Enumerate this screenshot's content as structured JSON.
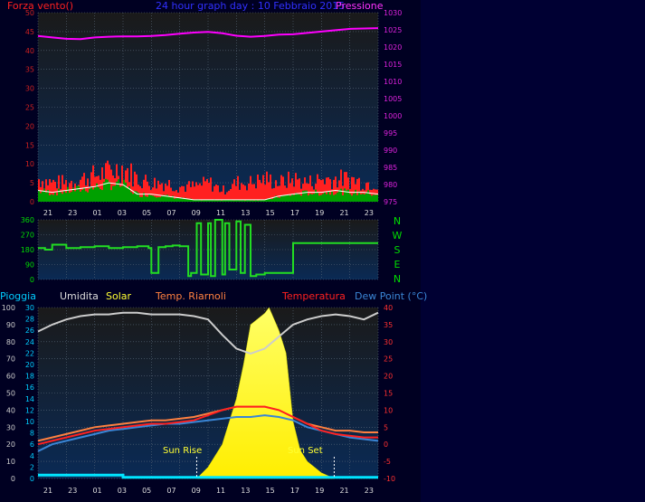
{
  "colors": {
    "page_bg": "#000033",
    "plot_bg_top": "#1a1a1a",
    "plot_bg_bottom": "#0a2a55",
    "grid": "#5a6a7a",
    "wind_gust": "#ff2020",
    "wind_avg": "#00a000",
    "wind_line": "#ffffff",
    "pressure": "#ff00ff",
    "direction": "#22dd22",
    "humidity": "#cccccc",
    "solar": "#ffff22",
    "temp_sheltered": "#ff8040",
    "temperature": "#ff2020",
    "dew_point": "#3a86d6",
    "rain": "#00e5ff",
    "left_axis_text": "#cc2020",
    "dir_axis_text": "#00dd00",
    "rain_axis_text": "#00ccff",
    "humidity_axis_text": "#cccccc"
  },
  "x_ticks": [
    "21",
    "23",
    "01",
    "03",
    "05",
    "07",
    "09",
    "11",
    "13",
    "15",
    "17",
    "19",
    "21",
    "23"
  ],
  "wind_chart": {
    "title": "24 hour graph day : 10 Febbraio 2015",
    "left_label": "Forza vento()",
    "right_label": "Pressione",
    "wind_range": [
      0,
      50
    ],
    "wind_ticks": [
      "0",
      "5",
      "10",
      "15",
      "20",
      "25",
      "30",
      "35",
      "40",
      "45",
      "50"
    ],
    "pressure_range": [
      975,
      1030
    ],
    "pressure_ticks": [
      "975",
      "980",
      "985",
      "990",
      "995",
      "1000",
      "1005",
      "1010",
      "1015",
      "1020",
      "1025",
      "1030"
    ],
    "pressure": {
      "x": [
        0,
        1,
        2,
        3,
        4,
        5,
        6,
        7,
        8,
        9,
        10,
        11,
        12,
        13,
        14,
        15,
        16,
        17,
        18,
        19,
        20,
        21,
        22,
        23,
        24
      ],
      "y": [
        1023.2,
        1022.8,
        1022.4,
        1022.3,
        1022.8,
        1023.0,
        1023.1,
        1023.1,
        1023.2,
        1023.5,
        1023.9,
        1024.2,
        1024.4,
        1024.0,
        1023.3,
        1023.0,
        1023.2,
        1023.6,
        1023.7,
        1024.1,
        1024.5,
        1024.9,
        1025.3,
        1025.4,
        1025.5
      ]
    },
    "wind_gust": {
      "x": [
        0,
        1,
        2,
        3,
        4,
        5,
        6,
        7,
        8,
        9,
        10,
        11,
        12,
        13,
        14,
        15,
        16,
        17,
        18,
        19,
        20,
        21,
        22,
        23,
        24
      ],
      "y": [
        6,
        5,
        5,
        6,
        7,
        8,
        9,
        6,
        5,
        5,
        4,
        4,
        5,
        3,
        5,
        5,
        6,
        5,
        6,
        5,
        6,
        6,
        6,
        5,
        5
      ]
    },
    "wind_avg": {
      "x": [
        0,
        1,
        2,
        3,
        4,
        5,
        6,
        7,
        8,
        9,
        10,
        11,
        12,
        13,
        14,
        15,
        16,
        17,
        18,
        19,
        20,
        21,
        22,
        23,
        24
      ],
      "y": [
        3,
        2.5,
        3,
        3.5,
        4,
        5,
        4.5,
        2,
        2,
        1.5,
        1,
        0.5,
        0.5,
        0.5,
        0.5,
        0.5,
        0.5,
        1.5,
        2,
        2.5,
        2.5,
        3,
        2.5,
        2.5,
        2
      ]
    }
  },
  "direction_chart": {
    "range": [
      0,
      360
    ],
    "ticks": [
      "0",
      "90",
      "180",
      "270",
      "360"
    ],
    "compass": [
      "N",
      "W",
      "S",
      "E",
      "N"
    ],
    "direction": {
      "x": [
        0,
        0.5,
        1,
        2,
        3,
        4,
        5,
        6,
        7,
        7.8,
        8,
        8.5,
        9,
        9.5,
        10,
        10.6,
        10.8,
        11.0,
        11.2,
        11.5,
        12,
        12.2,
        12.5,
        13,
        13.2,
        13.5,
        14,
        14.3,
        14.6,
        15,
        15.4,
        16,
        17,
        18,
        20,
        22,
        24
      ],
      "y": [
        190,
        180,
        210,
        190,
        195,
        200,
        190,
        195,
        200,
        190,
        40,
        195,
        200,
        205,
        200,
        20,
        40,
        40,
        340,
        30,
        340,
        20,
        360,
        30,
        340,
        60,
        350,
        40,
        330,
        20,
        30,
        40,
        40,
        220,
        220,
        220,
        220
      ]
    }
  },
  "lower_chart": {
    "labels": {
      "rain": "Pioggia",
      "humidity": "Umidita",
      "solar": "Solar",
      "temp_sheltered": "Temp. Riarnoli",
      "temperature": "Temperatura",
      "dew_point": "Dew Point (°C)"
    },
    "humidity_range": [
      0,
      100
    ],
    "humidity_ticks": [
      "0",
      "10",
      "20",
      "30",
      "40",
      "50",
      "60",
      "70",
      "80",
      "90",
      "100"
    ],
    "rain_range": [
      0,
      30
    ],
    "rain_ticks": [
      "0",
      "2",
      "4",
      "6",
      "8",
      "10",
      "12",
      "14",
      "16",
      "18",
      "20",
      "22",
      "24",
      "26",
      "28",
      "30"
    ],
    "temp_range": [
      -10,
      40
    ],
    "temp_ticks": [
      "-10",
      "-5",
      "0",
      "5",
      "10",
      "15",
      "20",
      "25",
      "30",
      "35",
      "40"
    ],
    "sun_rise_label": "Sun Rise",
    "sun_set_label": "Sun Set",
    "sun_rise_hour": 11.2,
    "sun_set_hour": 20.9,
    "humidity": {
      "x": [
        0,
        1,
        2,
        3,
        4,
        5,
        6,
        7,
        8,
        9,
        10,
        11,
        12,
        13,
        14,
        15,
        16,
        17,
        18,
        19,
        20,
        21,
        22,
        23,
        24
      ],
      "y": [
        86,
        90,
        93,
        95,
        96,
        96,
        97,
        97,
        96,
        96,
        96,
        95,
        93,
        84,
        76,
        73,
        76,
        83,
        90,
        93,
        95,
        96,
        95,
        93,
        97
      ]
    },
    "solar": {
      "x": [
        11.2,
        12,
        13,
        13.5,
        14,
        14.5,
        15,
        16,
        16.3,
        17,
        17.5,
        18,
        18.5,
        19,
        19.5,
        20,
        20.9
      ],
      "y": [
        0,
        2,
        6,
        10,
        14,
        20,
        27,
        29,
        30,
        26,
        22,
        10,
        5,
        3,
        2,
        1,
        0
      ]
    },
    "temp_sheltered": {
      "x": [
        0,
        1,
        2,
        3,
        4,
        5,
        6,
        7,
        8,
        9,
        10,
        11,
        12,
        13,
        14,
        15,
        16,
        17,
        18,
        19,
        20,
        21,
        22,
        23,
        24
      ],
      "y": [
        1,
        2,
        3,
        4,
        5,
        5.5,
        6,
        6.5,
        7,
        7,
        7.5,
        8,
        9,
        10,
        11,
        11,
        11,
        10,
        8,
        6,
        5,
        4,
        4,
        3.5,
        3.5
      ]
    },
    "temperature": {
      "x": [
        0,
        1,
        2,
        3,
        4,
        5,
        6,
        7,
        8,
        9,
        10,
        11,
        12,
        13,
        14,
        15,
        16,
        17,
        18,
        19,
        20,
        21,
        22,
        23,
        24
      ],
      "y": [
        0,
        1,
        2,
        3,
        4,
        4.5,
        5,
        5.5,
        6,
        6,
        6.5,
        7,
        8.5,
        10,
        11,
        11,
        11,
        10,
        8,
        6,
        4,
        3,
        2.5,
        2,
        2
      ]
    },
    "dew_point": {
      "x": [
        0,
        1,
        2,
        3,
        4,
        5,
        6,
        7,
        8,
        9,
        10,
        11,
        12,
        13,
        14,
        15,
        16,
        17,
        18,
        19,
        20,
        21,
        22,
        23,
        24
      ],
      "y": [
        -2,
        0,
        1,
        2,
        3,
        4,
        4.5,
        5,
        5.5,
        6,
        6,
        6.5,
        7,
        7.5,
        8,
        8,
        8.5,
        8,
        7,
        5,
        4,
        3,
        2,
        1.5,
        1
      ]
    },
    "rain": {
      "x": [
        0,
        1,
        2,
        3,
        4,
        5,
        6,
        7,
        8,
        9,
        10,
        11,
        12,
        13,
        14,
        15,
        16,
        17,
        18,
        19,
        20,
        21,
        22,
        23,
        24
      ],
      "y": [
        0.6,
        0.6,
        0.6,
        0.6,
        0.6,
        0.6,
        0.2,
        0.2,
        0.2,
        0.2,
        0.2,
        0.2,
        0.2,
        0.2,
        0.2,
        0.2,
        0.2,
        0.2,
        0.2,
        0.2,
        0.2,
        0.2,
        0.2,
        0.2,
        0.2
      ]
    }
  },
  "chart_data": [
    {
      "type": "line",
      "title": "24 hour graph day : 10 Febbraio 2015",
      "x_tick_labels": [
        "21",
        "23",
        "01",
        "03",
        "05",
        "07",
        "09",
        "11",
        "13",
        "15",
        "17",
        "19",
        "21",
        "23"
      ],
      "ylabel": "Forza vento()",
      "ylim": [
        0,
        50
      ],
      "y2label": "Pressione",
      "y2lim": [
        975,
        1030
      ],
      "series": [
        "Forza vento()",
        "Pressione"
      ]
    },
    {
      "type": "line",
      "ylim": [
        0,
        360
      ],
      "compass": [
        "N",
        "W",
        "S",
        "E",
        "N"
      ]
    },
    {
      "type": "line",
      "series": [
        "Pioggia",
        "Umidita",
        "Solar",
        "Temp. Riarnoli",
        "Temperatura",
        "Dew Point (°C)"
      ],
      "humidity_ylim": [
        0,
        100
      ],
      "rain_ylim": [
        0,
        30
      ],
      "temp_ylim": [
        -10,
        40
      ],
      "annotations": [
        "Sun Rise",
        "Sun Set"
      ]
    }
  ]
}
